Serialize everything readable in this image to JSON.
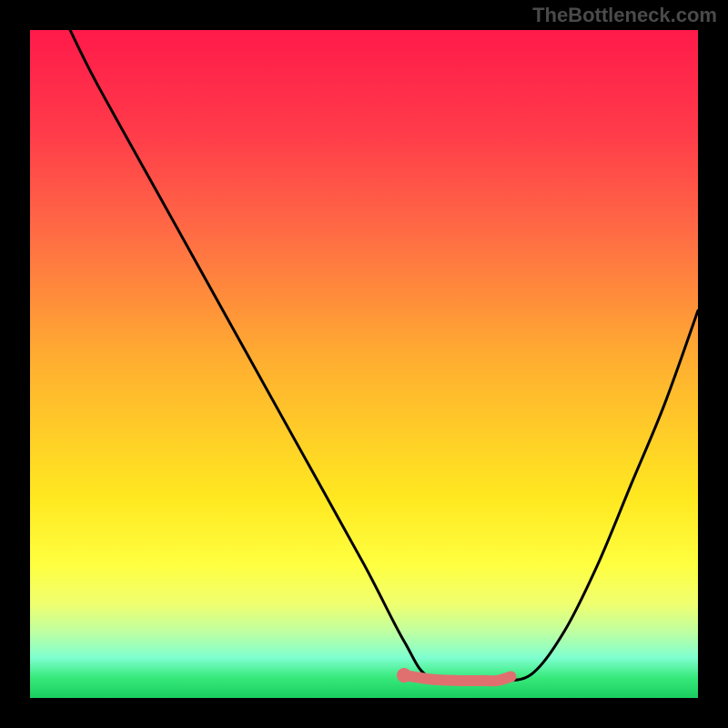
{
  "watermark": "TheBottleneck.com",
  "chart_data": {
    "type": "line",
    "title": "",
    "xlabel": "",
    "ylabel": "",
    "xlim": [
      0,
      100
    ],
    "ylim": [
      0,
      100
    ],
    "series": [
      {
        "name": "bottleneck-curve",
        "color": "#000000",
        "x": [
          6,
          10,
          20,
          30,
          40,
          50,
          56,
          60,
          68,
          70,
          75,
          80,
          85,
          90,
          95,
          100
        ],
        "y": [
          100,
          92,
          74,
          56,
          38,
          20,
          8.5,
          3.0,
          2.6,
          2.6,
          3.5,
          10,
          20,
          32,
          44,
          58
        ]
      },
      {
        "name": "highlight-segment",
        "color": "#e07070",
        "x": [
          56,
          60,
          64,
          68,
          70,
          72
        ],
        "y": [
          3.4,
          2.8,
          2.6,
          2.6,
          2.6,
          3.2
        ]
      }
    ],
    "highlight_dot": {
      "x": 56,
      "y": 3.4,
      "color": "#e07070"
    }
  }
}
